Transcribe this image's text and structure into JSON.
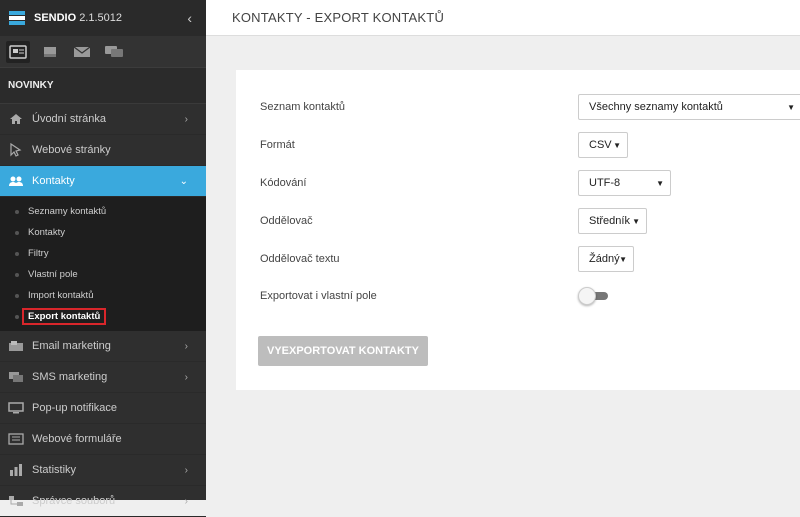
{
  "app": {
    "name": "SENDIO",
    "version": "2.1.5012"
  },
  "sidebar": {
    "section_label": "NOVINKY",
    "iconbar": [
      {
        "icon": "newspaper-icon"
      },
      {
        "icon": "inbox-icon"
      },
      {
        "icon": "envelope-icon"
      },
      {
        "icon": "chat-icon"
      }
    ],
    "items_top": [
      {
        "label": "Úvodní stránka",
        "icon": "home-icon",
        "arrow": "›"
      },
      {
        "label": "Webové stránky",
        "icon": "cursor-icon",
        "arrow": ""
      },
      {
        "label": "Kontakty",
        "icon": "users-icon",
        "arrow": "⌄"
      }
    ],
    "submenu": [
      "Seznamy kontaktů",
      "Kontakty",
      "Filtry",
      "Vlastní pole",
      "Import kontaktů",
      "Export kontaktů"
    ],
    "items_bottom": [
      {
        "label": "Email marketing",
        "icon": "email-icon",
        "arrow": "›"
      },
      {
        "label": "SMS marketing",
        "icon": "sms-icon",
        "arrow": "›"
      },
      {
        "label": "Pop-up notifikace",
        "icon": "monitor-icon",
        "arrow": ""
      },
      {
        "label": "Webové formuláře",
        "icon": "form-icon",
        "arrow": ""
      },
      {
        "label": "Statistiky",
        "icon": "bar-chart-icon",
        "arrow": "›"
      },
      {
        "label": "Správce souborů",
        "icon": "folder-tree-icon",
        "arrow": "›"
      }
    ]
  },
  "header": {
    "title": "KONTAKTY - EXPORT KONTAKTŮ"
  },
  "form": {
    "list_label": "Seznam kontaktů",
    "list_value": "Všechny seznamy kontaktů",
    "format_label": "Formát",
    "format_value": "CSV",
    "encoding_label": "Kódování",
    "encoding_value": "UTF-8",
    "separator_label": "Oddělovač",
    "separator_value": "Středník",
    "text_separator_label": "Oddělovač textu",
    "text_separator_value": "Žádný",
    "custom_fields_label": "Exportovat i vlastní pole",
    "custom_fields_enabled": false,
    "submit_label": "VYEXPORTOVAT KONTAKTY"
  },
  "colors": {
    "accent": "#3aa9dd",
    "sidebar": "#2f2f2f",
    "highlight_border": "#d9262b"
  }
}
